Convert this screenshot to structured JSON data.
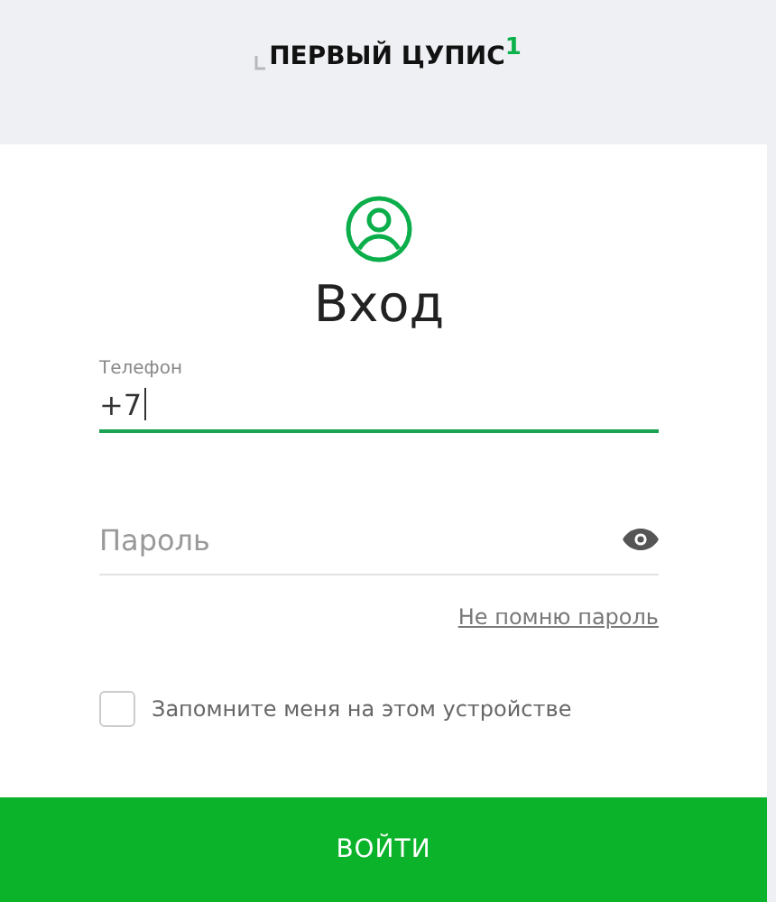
{
  "logo": {
    "text": "ПЕРВЫЙ ЦУПИС$^{1}$"
  },
  "title": "Вход",
  "phone": {
    "label": "Телефон",
    "value": "+7",
    "focused": true
  },
  "password": {
    "placeholder": "Пароль"
  },
  "forgot_link": "Не помню пароль",
  "remember": {
    "label": "Запомните меня на этом устройстве",
    "checked": false
  },
  "submit": "ВОЙТИ"
}
